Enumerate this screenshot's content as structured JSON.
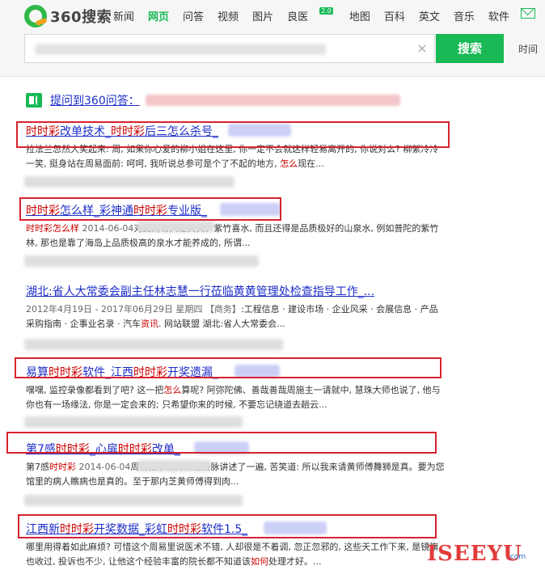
{
  "header": {
    "logo_text": "360搜索",
    "nav": [
      {
        "label": "新闻",
        "active": false
      },
      {
        "label": "网页",
        "active": true
      },
      {
        "label": "问答",
        "active": false
      },
      {
        "label": "视频",
        "active": false
      },
      {
        "label": "图片",
        "active": false
      },
      {
        "label": "良医",
        "active": false,
        "badge": "2.0"
      },
      {
        "label": "地图",
        "active": false
      },
      {
        "label": "百科",
        "active": false
      },
      {
        "label": "英文",
        "active": false
      },
      {
        "label": "音乐",
        "active": false
      },
      {
        "label": "软件",
        "active": false
      }
    ],
    "search_button": "搜索",
    "time_link": "时间",
    "clear_glyph": "×",
    "mail_icon": "mail-icon",
    "accent_color": "#19b955"
  },
  "wenda": {
    "label": "提问到360问答："
  },
  "results": [
    {
      "title_parts": [
        [
          "hl",
          "时时彩"
        ],
        [
          "",
          "改单技术_"
        ],
        [
          "hl",
          "时时彩"
        ],
        [
          "",
          "后三怎么杀号_"
        ]
      ],
      "snippet_parts": [
        [
          "",
          "拉法兰忽然大笑起来: 周, 如果你心爱的柳小姐在这里, 你一定不会就这样轻易离开的, 你说对么? 柳絮冷冷一笑, 挺身站在周易面前: 呵呵, 我听说总参可是个了不起的地方, "
        ],
        [
          "hl",
          "怎么"
        ],
        [
          "",
          "现在..."
        ]
      ]
    },
    {
      "title_parts": [
        [
          "hl",
          "时时彩"
        ],
        [
          "",
          "怎么样_彩神通"
        ],
        [
          "hl",
          "时时彩"
        ],
        [
          "",
          "专业版_"
        ]
      ],
      "snippet_parts": [
        [
          "hl",
          "时时彩怎么样"
        ],
        [
          "date",
          " 2014-06-04"
        ],
        [
          "",
          "对此周易只是笑笑。紫竹喜水, 而且还得是品质极好的山泉水, 例如普陀的紫竹林, 那也是靠了海岛上品质极高的泉水才能养成的, 所谓..."
        ]
      ]
    },
    {
      "title_parts": [
        [
          "",
          "湖北:省人大常委会副主任林志慧一行莅临黄黄管理处检查指导工作_..."
        ]
      ],
      "snippet_parts": [
        [
          "date",
          "2012年4月19日 - 2017年06月29日 星期四 【商务】"
        ],
        [
          "",
          ":工程信息 · 建设市场 · 企业风采 · 会展信息 · 产品采购指南 · 企事业名录 · 汽车"
        ],
        [
          "hl",
          "资讯"
        ],
        [
          "",
          ". 网站联盟 湖北:省人大常委会..."
        ]
      ]
    },
    {
      "title_parts": [
        [
          "",
          "易算"
        ],
        [
          "hl",
          "时时彩"
        ],
        [
          "",
          "软件_江西"
        ],
        [
          "hl",
          "时时彩"
        ],
        [
          "",
          "开奖遗漏_"
        ]
      ],
      "snippet_parts": [
        [
          "",
          "嘿嘿, 监控录像都看到了吧? 这一把"
        ],
        [
          "hl",
          "怎么"
        ],
        [
          "",
          "算呢? 阿弥陀佛、善哉善哉周施主一请就中, 慧珠大师也说了, 他与你也有一场缘法, 你是一定会来的; 只希望你来的时候, 不要忘记绕道去趟云..."
        ]
      ]
    },
    {
      "title_parts": [
        [
          "",
          "第7感"
        ],
        [
          "hl",
          "时时彩"
        ],
        [
          "",
          "_心扉"
        ],
        [
          "hl",
          "时时彩"
        ],
        [
          "",
          "改单_"
        ]
      ],
      "snippet_parts": [
        [
          "",
          "第7感"
        ],
        [
          "hl",
          "时时彩"
        ],
        [
          "date",
          " 2014-06-04"
        ],
        [
          "",
          "周易把事情的来龙去脉讲述了一遍, 苦笑道: 所以我来请黄师傅舞狮是真。要为您馆里的病人瞧病也是真的。至于那内芝黄师傅得到肉..."
        ]
      ]
    },
    {
      "title_parts": [
        [
          "",
          "江西新"
        ],
        [
          "hl",
          "时时彩"
        ],
        [
          "",
          "开奖数据_彩虹"
        ],
        [
          "hl",
          "时时彩"
        ],
        [
          "",
          "软件1.5_"
        ]
      ],
      "snippet_parts": [
        [
          "",
          "哪里用得着如此麻烦? 可惜这个周易里说医术不错, 人却很是不着调, 忽正忽邪的, 这些天工作下来, 是镜旗也收过, 投诉也不少, 让他这个经验丰富的院长都不知道该"
        ],
        [
          "hl",
          "如何"
        ],
        [
          "",
          "处理才好。..."
        ]
      ]
    }
  ],
  "watermark": {
    "text": "ISEEYU",
    "sub": ".com"
  }
}
